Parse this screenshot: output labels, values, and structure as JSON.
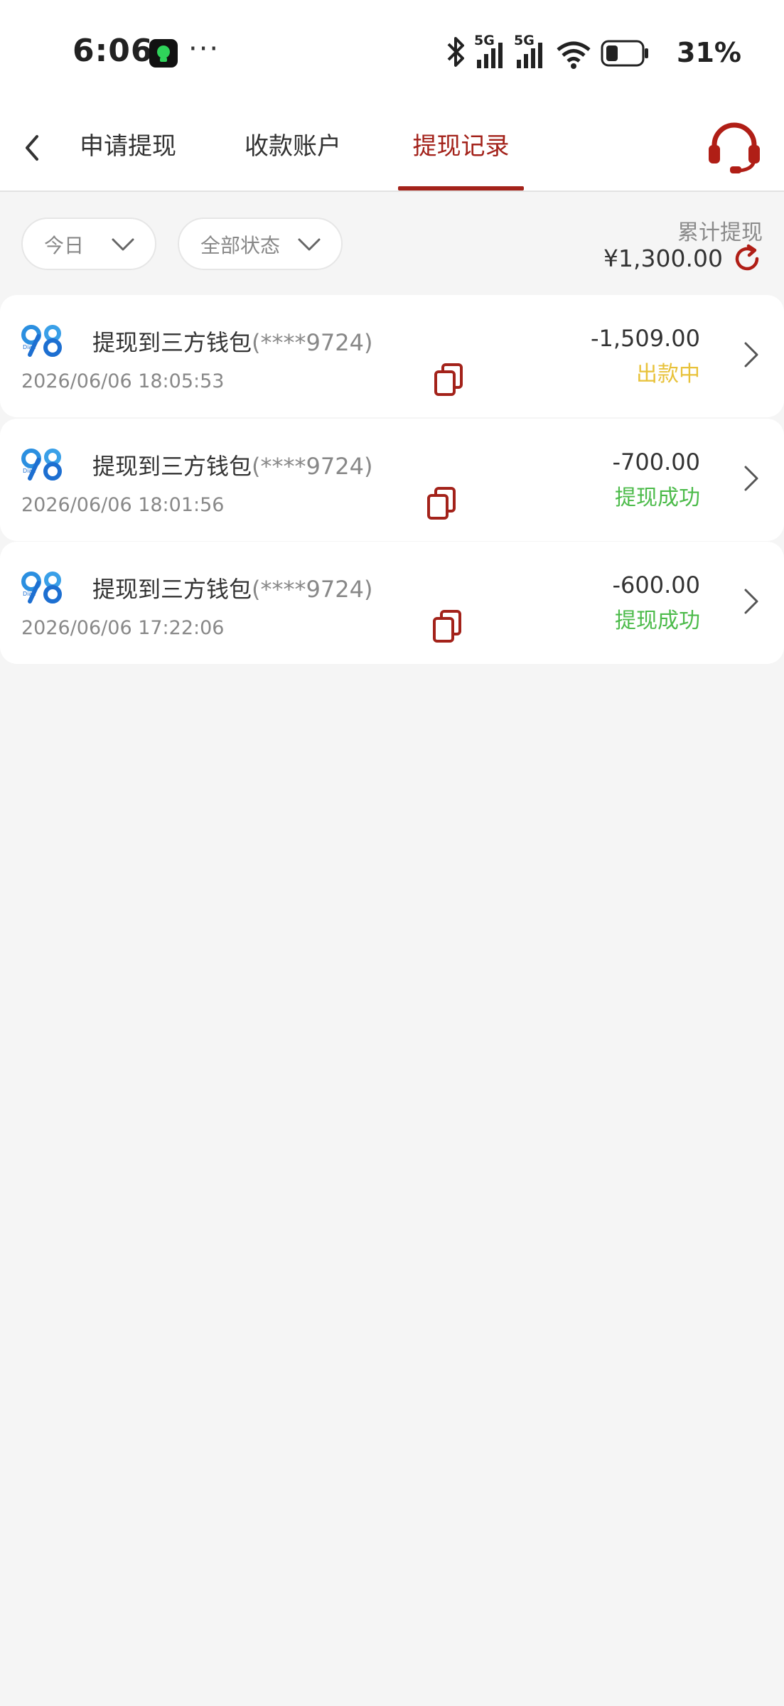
{
  "status_bar": {
    "time": "6:06",
    "more": "···",
    "battery": "31%",
    "network_1": "5G",
    "network_2": "5G"
  },
  "header": {
    "tabs": [
      {
        "label": "申请提现",
        "active": false
      },
      {
        "label": "收款账户",
        "active": false
      },
      {
        "label": "提现记录",
        "active": true
      }
    ]
  },
  "filters": {
    "date": "今日",
    "status": "全部状态"
  },
  "summary": {
    "label": "累计提现",
    "amount": "¥1,300.00"
  },
  "records": [
    {
      "title": "提现到三方钱包",
      "account": "(****9724)",
      "time": "2026/06/06 18:05:53",
      "amount": "-1,509.00",
      "status": "出款中",
      "status_color": "#e8c23a"
    },
    {
      "title": "提现到三方钱包",
      "account": "(****9724)",
      "time": "2026/06/06 18:01:56",
      "amount": "-700.00",
      "status": "提现成功",
      "status_color": "#4cbb4a"
    },
    {
      "title": "提现到三方钱包",
      "account": "(****9724)",
      "time": "2026/06/06 17:22:06",
      "amount": "-600.00",
      "status": "提现成功",
      "status_color": "#4cbb4a"
    }
  ],
  "colors": {
    "accent": "#a3221a",
    "background": "#f5f5f5"
  },
  "icons": [
    "back-icon",
    "headset-icon",
    "chevron-down-icon",
    "refresh-icon",
    "wallet-logo-icon",
    "copy-icon",
    "chevron-right-icon"
  ]
}
